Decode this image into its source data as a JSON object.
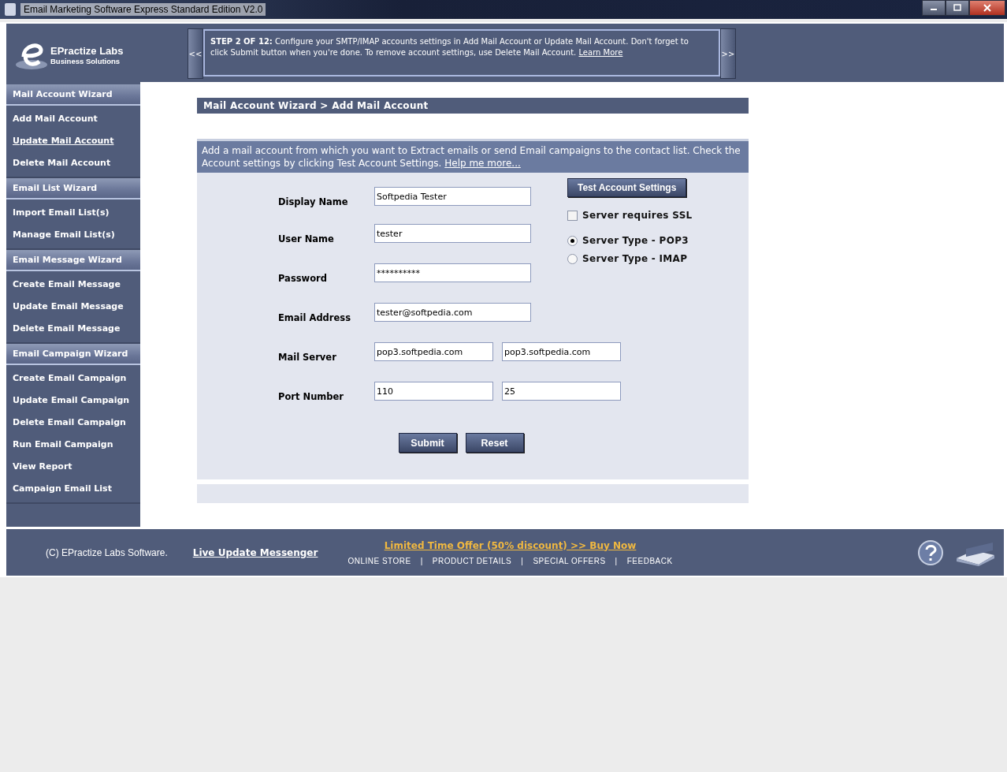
{
  "window": {
    "title": "Email Marketing Software Express Standard Edition V2.0"
  },
  "logo": {
    "name": "EPractize Labs",
    "tagline": "Business Solutions"
  },
  "step": {
    "prev": "<<",
    "next": ">>",
    "text": "**STEP 2 OF 12:** Configure your SMTP/IMAP accounts settings in Add Mail Account or Update Mail Account. Don't forget to click Submit button when you're done. To remove account settings, use Delete Mail Account.",
    "link": "Learn More"
  },
  "sidebar": [
    {
      "title": "Mail Account Wizard",
      "items": [
        {
          "label": "Add Mail Account",
          "selected": false
        },
        {
          "label": "Update Mail Account",
          "selected": true
        },
        {
          "label": "Delete Mail Account",
          "selected": false
        }
      ]
    },
    {
      "title": "Email List Wizard",
      "items": [
        {
          "label": "Import Email List(s)",
          "selected": false
        },
        {
          "label": "Manage Email List(s)",
          "selected": false
        }
      ]
    },
    {
      "title": "Email Message Wizard",
      "items": [
        {
          "label": "Create Email Message",
          "selected": false
        },
        {
          "label": "Update Email Message",
          "selected": false
        },
        {
          "label": "Delete Email Message",
          "selected": false
        }
      ]
    },
    {
      "title": "Email Campaign Wizard",
      "items": [
        {
          "label": "Create Email Campaign",
          "selected": false
        },
        {
          "label": "Update Email Campaign",
          "selected": false
        },
        {
          "label": "Delete Email Campaign",
          "selected": false
        },
        {
          "label": "Run Email Campaign",
          "selected": false
        },
        {
          "label": "View Report",
          "selected": false
        },
        {
          "label": "Campaign Email List",
          "selected": false
        }
      ]
    }
  ],
  "breadcrumb": "Mail Account Wizard > Add Mail Account",
  "intro": {
    "text": "Add a mail account from which you want to Extract emails or send Email campaigns to the contact list. Check the Account settings by clicking Test Account Settings.",
    "link": "Help me more..."
  },
  "fields": [
    {
      "label": "Display Name",
      "values": [
        "Softpedia Tester"
      ]
    },
    {
      "label": "User Name",
      "values": [
        "tester"
      ]
    },
    {
      "label": "Password",
      "values": [
        "**********"
      ]
    },
    {
      "label": "Email Address",
      "values": [
        "tester@softpedia.com"
      ]
    },
    {
      "label": "Mail Server",
      "values": [
        "pop3.softpedia.com",
        "pop3.softpedia.com"
      ]
    },
    {
      "label": "Port Number",
      "values": [
        "110",
        "25"
      ]
    }
  ],
  "test_button": "Test Account Settings",
  "ssl": {
    "label": "Server requires SSL",
    "checked": false
  },
  "server_types": [
    {
      "label": "Server Type - POP3",
      "selected": true
    },
    {
      "label": "Server Type - IMAP",
      "selected": false
    }
  ],
  "buttons": [
    "Submit",
    "Reset"
  ],
  "footer": {
    "copyright": "(C) EPractize Labs Software.",
    "live_update": "Live Update Messenger",
    "offer": "Limited Time Offer (50% discount) >> Buy Now",
    "links": [
      "ONLINE STORE",
      "PRODUCT DETAILS",
      "SPECIAL OFFERS",
      "FEEDBACK"
    ],
    "separator": "|"
  }
}
